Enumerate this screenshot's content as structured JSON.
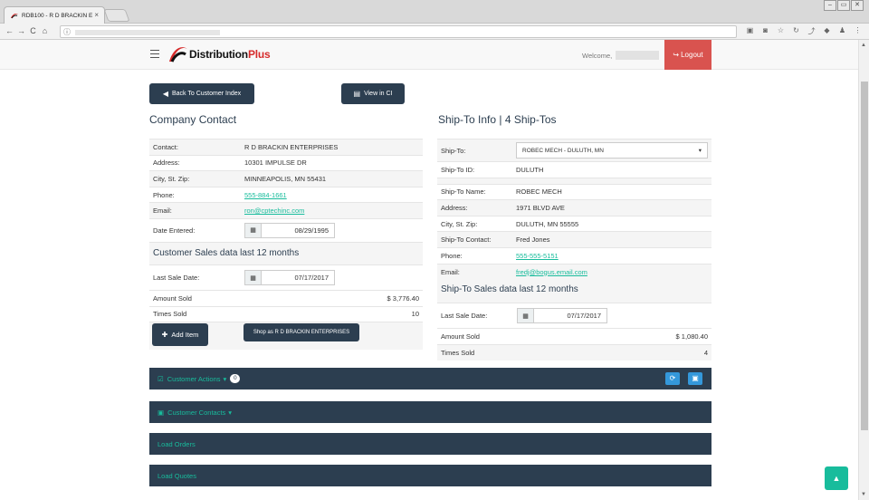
{
  "browser": {
    "tab_title": "RDB100 - R D BRACKIN E",
    "tab_close": "×",
    "url_info_icon": "ⓘ",
    "window_buttons": [
      "–",
      "▭",
      "✕"
    ],
    "nav_icons": [
      "←",
      "→",
      "C",
      "⌂"
    ],
    "extensions": [
      "▣",
      "◙",
      "☆",
      "↻",
      "⤴",
      "◆",
      "♟",
      "⋮"
    ]
  },
  "topnav": {
    "brand_main": "Distribution",
    "brand_plus": "Plus",
    "welcome": "Welcome,",
    "logout": "Logout",
    "logout_icon": "↪"
  },
  "actions": {
    "back": "Back To Customer Index",
    "back_icon": "◀",
    "view_ci": "View in CI",
    "view_ci_icon": "▤"
  },
  "company": {
    "heading": "Company Contact",
    "rows": [
      {
        "label": "Contact:",
        "value": "R D BRACKIN ENTERPRISES"
      },
      {
        "label": "Address:",
        "value": "10301 IMPULSE DR"
      },
      {
        "label": "City, St. Zip:",
        "value": "MINNEAPOLIS, MN 55431"
      },
      {
        "label": "Phone:",
        "value": "555-884-1661"
      },
      {
        "label": "Email:",
        "value": "ron@cptechinc.com"
      }
    ],
    "date_label": "Date Entered:",
    "date_value": "08/29/1995",
    "sales_heading": "Customer Sales data last 12 months",
    "last_sale_label": "Last Sale Date:",
    "last_sale_value": "07/17/2017",
    "amount_label": "Amount Sold",
    "amount_value": "$ 3,776.40",
    "times_label": "Times Sold",
    "times_value": "10",
    "add_item": "Add Item",
    "add_item_icon": "✚",
    "shop_as": "Shop as R D BRACKIN ENTERPRISES"
  },
  "shipto": {
    "heading": "Ship-To Info | 4 Ship-Tos",
    "shipto_label": "Ship-To:",
    "shipto_selected": "ROBEC MECH - DULUTH, MN",
    "rows": [
      {
        "label": "Ship-To ID:",
        "value": "DULUTH"
      },
      {
        "label": "Ship-To Name:",
        "value": "ROBEC MECH"
      },
      {
        "label": "Address:",
        "value": "1971 BLVD AVE"
      },
      {
        "label": "City, St. Zip:",
        "value": "DULUTH, MN 55555"
      },
      {
        "label": "Ship-To Contact:",
        "value": "Fred Jones"
      },
      {
        "label": "Phone:",
        "value": "555-555-5151"
      },
      {
        "label": "Email:",
        "value": "fredj@bogus.email.com"
      }
    ],
    "sales_heading": "Ship-To Sales data last 12 months",
    "last_sale_label": "Last Sale Date:",
    "last_sale_value": "07/17/2017",
    "amount_label": "Amount Sold",
    "amount_value": "$ 1,080.40",
    "times_label": "Times Sold",
    "times_value": "4"
  },
  "bars": {
    "customer_actions": "Customer Actions",
    "customer_actions_icon": "☑",
    "customer_actions_count": "0",
    "customer_contacts": "Customer Contacts",
    "customer_contacts_icon": "▣",
    "load_orders": "Load Orders",
    "load_quotes": "Load Quotes",
    "refresh_icon": "⟳",
    "save_icon": "▣"
  },
  "colors": {
    "primary": "#2c3e50",
    "accent": "#18bc9c",
    "danger": "#d9534f",
    "info": "#3498db"
  }
}
